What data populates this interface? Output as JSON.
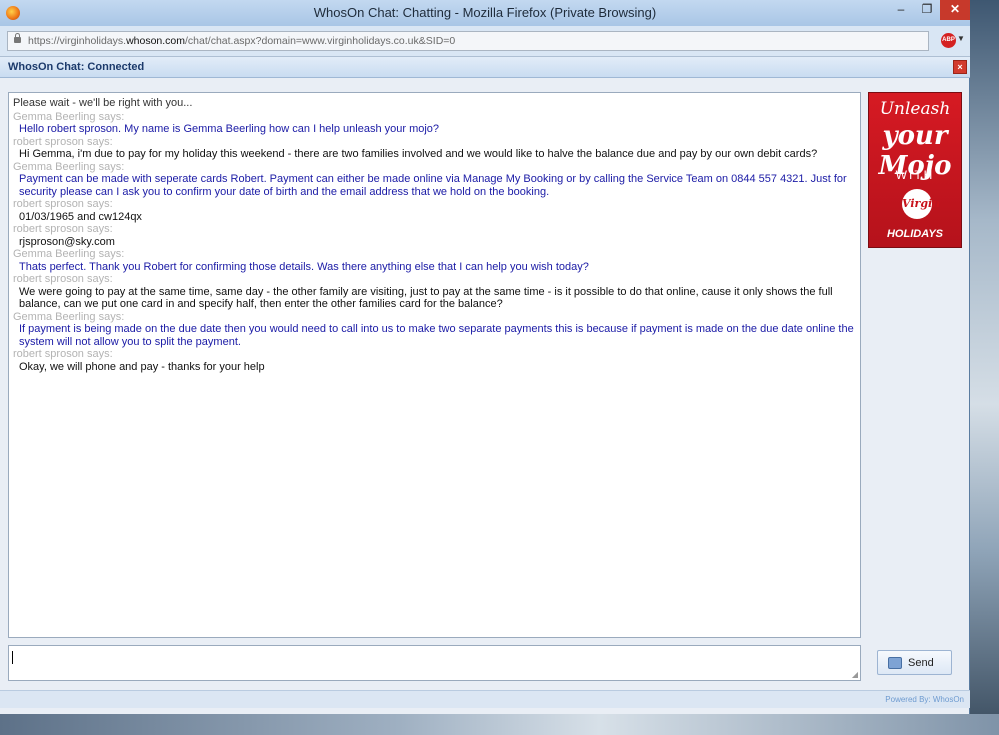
{
  "browser": {
    "title": "WhosOn Chat: Chatting - Mozilla Firefox (Private Browsing)",
    "window_buttons": {
      "minimize": "–",
      "maximize": "❐",
      "close": "✕"
    },
    "url_prefix": "https://virginholidays.",
    "url_domain": "whoson.com",
    "url_suffix": "/chat/chat.aspx?domain=www.virginholidays.co.uk&SID=0",
    "abp_label": "ABP"
  },
  "chat": {
    "header_title": "WhosOn Chat: Connected",
    "close_symbol": "×",
    "send_label": "Send",
    "powered_by": "Powered By: WhosOn",
    "input_value": "",
    "messages": {
      "system": "Please wait - we'll be right with you...",
      "m1": {
        "sender": "Gemma Beerling says:",
        "text": "Hello robert sproson. My name is Gemma Beerling how can I help unleash your mojo?"
      },
      "m2": {
        "sender": "robert sproson says:",
        "text": "Hi Gemma, i'm due to pay for my holiday this weekend - there are two families involved and we would like to halve the balance due and pay by our own debit cards?"
      },
      "m3": {
        "sender": "Gemma Beerling says:",
        "text": "Payment can be made with seperate cards Robert. Payment can either be made online via Manage My Booking or by calling the Service Team on 0844 557 4321. Just for security please can I ask you to confirm your date of birth and the email address that we hold on the booking."
      },
      "m4": {
        "sender": "robert sproson says:",
        "text": "01/03/1965 and cw124qx"
      },
      "m5": {
        "sender": "robert sproson says:",
        "text": "rjsproson@sky.com"
      },
      "m6": {
        "sender": "Gemma Beerling says:",
        "text": "Thats perfect. Thank you Robert for confirming those details. Was there anything else that I can help you wish today?"
      },
      "m7": {
        "sender": "robert sproson says:",
        "text": "We were going to pay at the same time, same day - the other family are visiting, just to pay at the same time - is it possible to do that online, cause it only shows the full balance, can we put one card in and specify half, then enter the other families card for the balance?"
      },
      "m8": {
        "sender": "Gemma Beerling says:",
        "text": "If payment is being made on the due date then you would need to call into us to make two separate payments this is because if payment is made on the due date online the system will not allow you to split the payment."
      },
      "m9": {
        "sender": "robert sproson says:",
        "text": "Okay, we will phone and pay - thanks for your help"
      }
    }
  },
  "ad": {
    "line1": "Unleash",
    "line2": "your Mojo",
    "line3": "WITH",
    "logo": "Virgin",
    "line4": "HOLIDAYS"
  },
  "colors": {
    "agent_text": "#1b1ba6",
    "visitor_text": "#111111",
    "sender_label": "#b3b3b3",
    "ad_red": "#d61a23"
  }
}
